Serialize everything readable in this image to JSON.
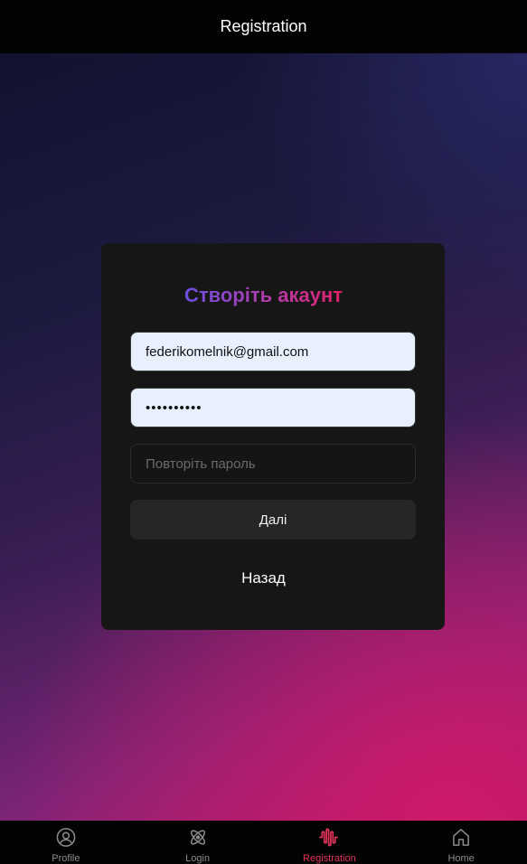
{
  "header": {
    "title": "Registration"
  },
  "form": {
    "title": "Створіть акаунт",
    "email_value": "federikomelnik@gmail.com",
    "password_value": "••••••••••",
    "repeat_placeholder": "Повторіть пароль",
    "next_label": "Далі",
    "back_label": "Назад"
  },
  "nav": {
    "items": [
      {
        "label": "Profile",
        "icon": "user-circle-icon",
        "active": false
      },
      {
        "label": "Login",
        "icon": "atom-icon",
        "active": false
      },
      {
        "label": "Registration",
        "icon": "waveform-icon",
        "active": true
      },
      {
        "label": "Home",
        "icon": "home-icon",
        "active": false
      }
    ]
  },
  "colors": {
    "accent": "#e2345a",
    "title_gradient_start": "#6a4fe0",
    "title_gradient_end": "#e0216b",
    "card_bg": "#161616",
    "input_filled_bg": "#e8effd"
  }
}
